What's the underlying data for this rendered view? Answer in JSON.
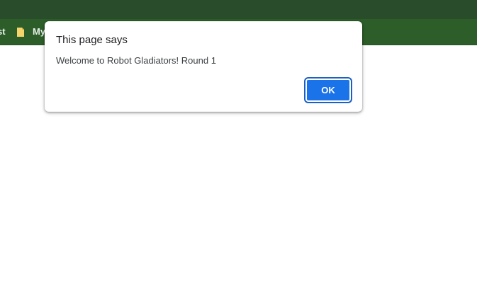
{
  "browser": {
    "bookmarks": [
      {
        "label": "st"
      },
      {
        "label": "My",
        "icon": "folder-icon"
      }
    ],
    "colors": {
      "title_strip": "#294d2a",
      "bookmarks_bar": "#2d5e2a"
    }
  },
  "dialog": {
    "title": "This page says",
    "message": "Welcome to Robot Gladiators! Round 1",
    "ok_label": "OK",
    "accent": "#1a73e8"
  }
}
